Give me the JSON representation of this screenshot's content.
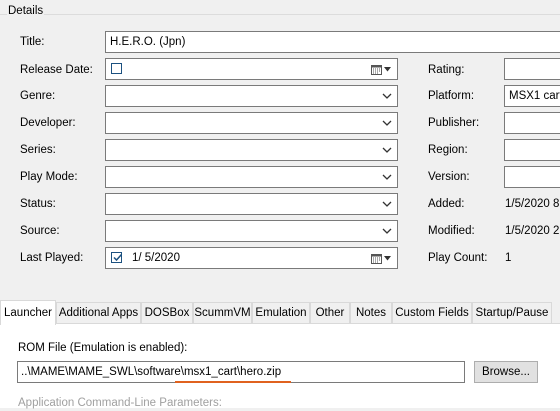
{
  "group": {
    "title": "Details"
  },
  "labels": {
    "title": "Title:",
    "release_date": "Release Date:",
    "genre": "Genre:",
    "developer": "Developer:",
    "series": "Series:",
    "play_mode": "Play Mode:",
    "status": "Status:",
    "source": "Source:",
    "last_played": "Last Played:",
    "rating": "Rating:",
    "platform": "Platform:",
    "publisher": "Publisher:",
    "region": "Region:",
    "version": "Version:",
    "added": "Added:",
    "modified": "Modified:",
    "play_count": "Play Count:"
  },
  "values": {
    "title": "H.E.R.O. (Jpn)",
    "last_played": "1/  5/2020",
    "platform": "MSX1 cartri",
    "added": "1/5/2020 8:",
    "modified": "1/5/2020 2:",
    "play_count": "1"
  },
  "checkboxes": {
    "release_date_checked": false,
    "last_played_checked": true
  },
  "tabs": [
    {
      "label": "Launcher",
      "active": true
    },
    {
      "label": "Additional Apps"
    },
    {
      "label": "DOSBox"
    },
    {
      "label": "ScummVM"
    },
    {
      "label": "Emulation"
    },
    {
      "label": "Other"
    },
    {
      "label": "Notes"
    },
    {
      "label": "Custom Fields"
    },
    {
      "label": "Startup/Pause"
    }
  ],
  "launcher": {
    "rom_label": "ROM File (Emulation is enabled):",
    "rom_path": "..\\MAME\\MAME_SWL\\software\\msx1_cart\\hero.zip",
    "browse_label": "Browse...",
    "cmdline_label": "Application Command-Line Parameters:"
  },
  "colors": {
    "highlight_underline": "#e0621f",
    "checkbox_border": "#1c5180"
  },
  "icons": {
    "dropdown": "chevron-down-icon",
    "date_picker": "calendar-icon",
    "checkmark": "checkmark-icon"
  }
}
